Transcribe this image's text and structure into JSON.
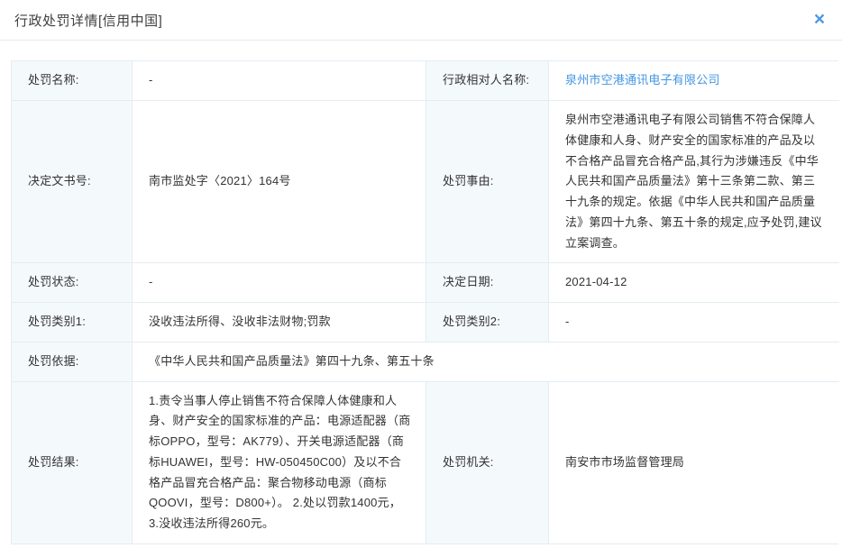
{
  "header": {
    "title": "行政处罚详情[信用中国]",
    "close_icon": "×"
  },
  "colors": {
    "accent_blue": "#4a9ae4",
    "link_blue": "#4295e2",
    "label_bg": "#f4f9fc",
    "border": "#e4ecf3"
  },
  "fields": {
    "penalty_name_label": "处罚名称:",
    "penalty_name_value": "-",
    "counterpart_label": "行政相对人名称:",
    "counterpart_value": "泉州市空港通讯电子有限公司",
    "doc_no_label": "决定文书号:",
    "doc_no_value": "南市监处字〈2021〉164号",
    "reason_label": "处罚事由:",
    "reason_value": "泉州市空港通讯电子有限公司销售不符合保障人体健康和人身、财产安全的国家标准的产品及以不合格产品冒充合格产品,其行为涉嫌违反《中华人民共和国产品质量法》第十三条第二款、第三十九条的规定。依据《中华人民共和国产品质量法》第四十九条、第五十条的规定,应予处罚,建议立案调查。",
    "status_label": "处罚状态:",
    "status_value": "-",
    "decision_date_label": "决定日期:",
    "decision_date_value": "2021-04-12",
    "category1_label": "处罚类别1:",
    "category1_value": "没收违法所得、没收非法财物;罚款",
    "category2_label": "处罚类别2:",
    "category2_value": "-",
    "basis_label": "处罚依据:",
    "basis_value": "《中华人民共和国产品质量法》第四十九条、第五十条",
    "result_label": "处罚结果:",
    "result_value": "1.责令当事人停止销售不符合保障人体健康和人身、财产安全的国家标准的产品：电源适配器（商标OPPO，型号：AK779）、开关电源适配器（商标HUAWEI，型号：HW-050450C00）及以不合格产品冒充合格产品：聚合物移动电源（商标QOOVI，型号：D800+）。 2.处以罚款1400元， 3.没收违法所得260元。",
    "authority_label": "处罚机关:",
    "authority_value": "南安市市场监督管理局"
  }
}
